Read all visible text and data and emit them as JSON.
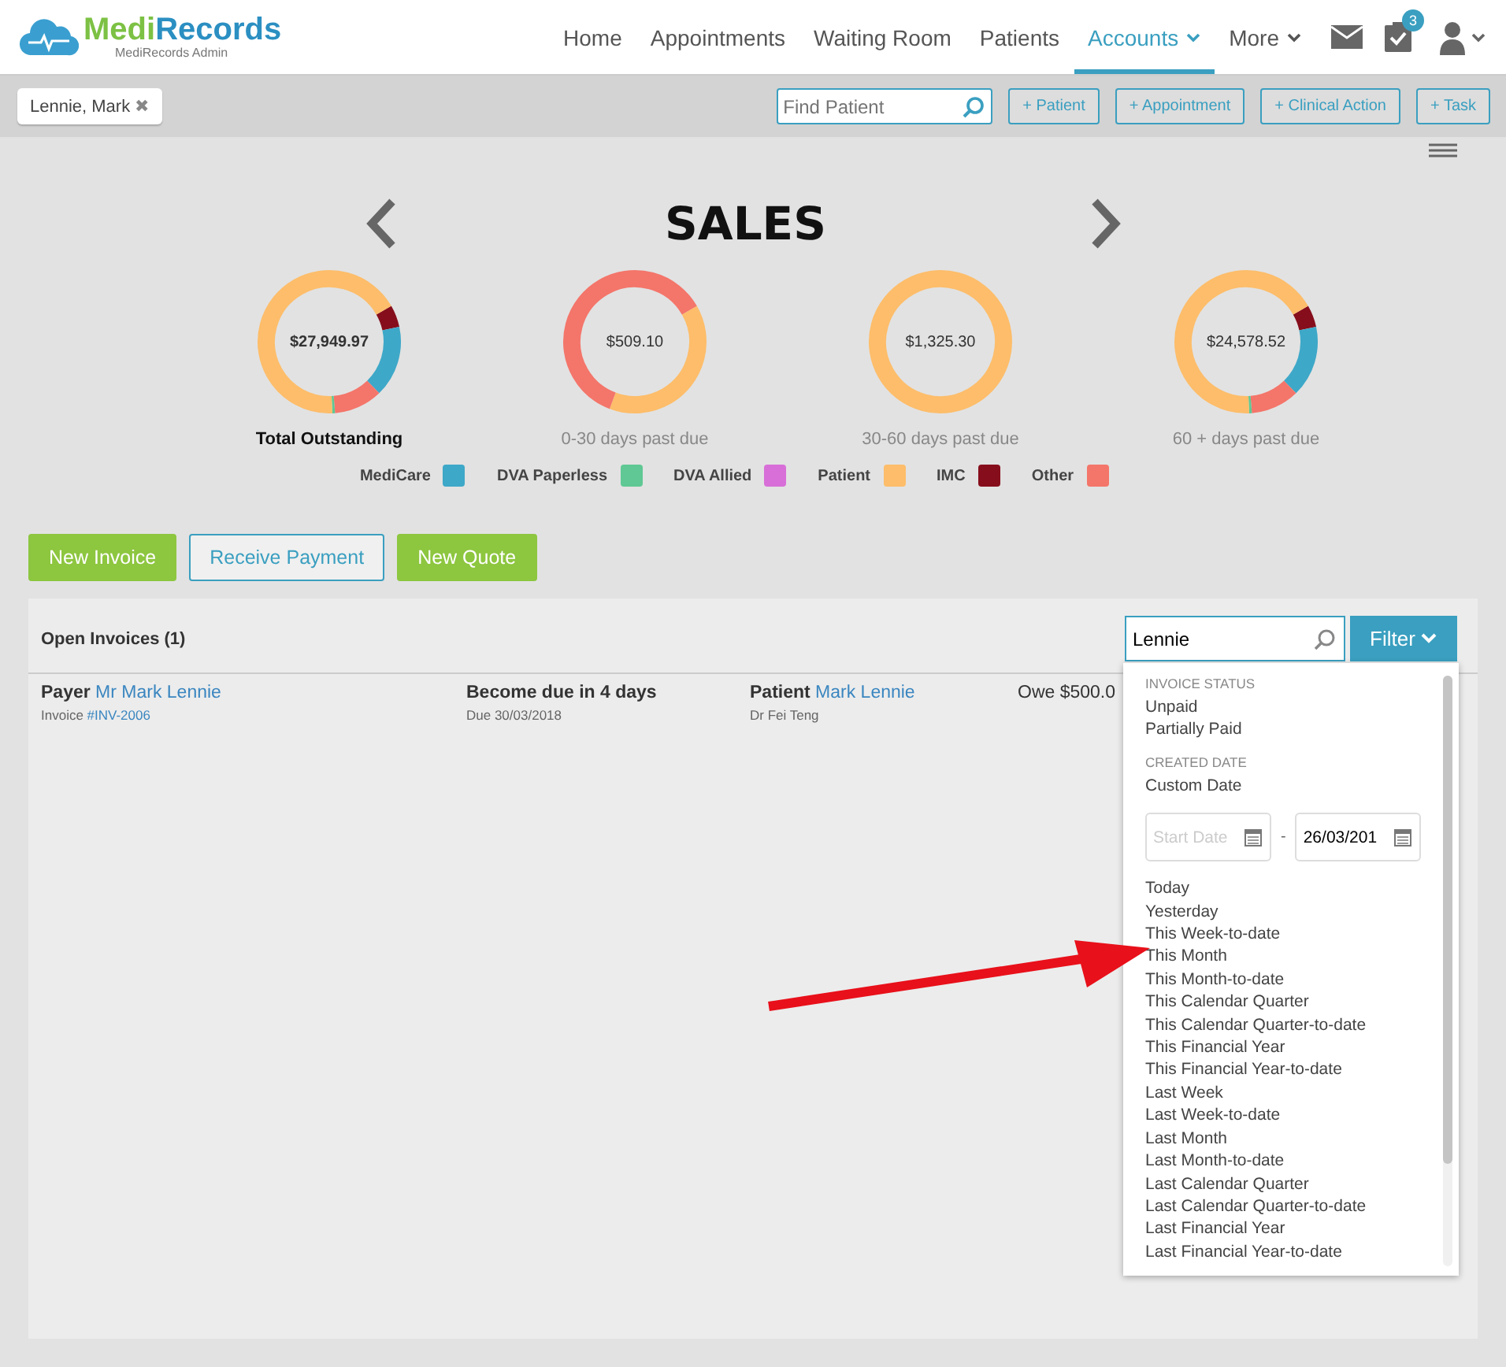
{
  "brand": {
    "name_part_1": "Medi",
    "name_part_2": "Records",
    "subtitle": "MediRecords Admin"
  },
  "nav": [
    {
      "label": "Home",
      "selected": false,
      "has_menu": false
    },
    {
      "label": "Appointments",
      "selected": false,
      "has_menu": false
    },
    {
      "label": "Waiting Room",
      "selected": false,
      "has_menu": false
    },
    {
      "label": "Patients",
      "selected": false,
      "has_menu": false
    },
    {
      "label": "Accounts",
      "selected": true,
      "has_menu": true
    },
    {
      "label": "More",
      "selected": false,
      "has_menu": true
    }
  ],
  "tasks_badge": "3",
  "patient_tab": {
    "label": "Lennie, Mark",
    "close": "✖"
  },
  "find_patient": {
    "placeholder": "Find Patient"
  },
  "quick_actions": [
    "+ Patient",
    "+ Appointment",
    "+ Clinical Action",
    "+ Task"
  ],
  "sales": {
    "title": "SALES",
    "donuts": [
      {
        "total": "$27,949.97",
        "label": "Total Outstanding",
        "emphasis": true
      },
      {
        "total": "$509.10",
        "label": "0-30 days past due",
        "emphasis": false
      },
      {
        "total": "$1,325.30",
        "label": "30-60 days past due",
        "emphasis": false
      },
      {
        "total": "$24,578.52",
        "label": "60 + days past due",
        "emphasis": false
      }
    ],
    "legend": [
      {
        "label": "MediCare",
        "color": "#3ea8c8"
      },
      {
        "label": "DVA Paperless",
        "color": "#5fc894"
      },
      {
        "label": "DVA Allied",
        "color": "#d86fd8"
      },
      {
        "label": "Patient",
        "color": "#fdbd6a"
      },
      {
        "label": "IMC",
        "color": "#860e1c"
      },
      {
        "label": "Other",
        "color": "#f4756a"
      }
    ]
  },
  "actions": [
    {
      "label": "New Invoice",
      "kind": "primary"
    },
    {
      "label": "Receive Payment",
      "kind": "outline"
    },
    {
      "label": "New Quote",
      "kind": "primary"
    }
  ],
  "invoices": {
    "title": "Open Invoices (1)",
    "search": {
      "value": "Lennie"
    },
    "filter_button": "Filter",
    "rows": [
      {
        "payer_label": "Payer",
        "payer": "Mr Mark Lennie",
        "invoice_label": "Invoice",
        "invoice": "#INV-2006",
        "due": "Become due in 4 days",
        "due_date": "Due 30/03/2018",
        "patient_label": "Patient",
        "patient": "Mark Lennie",
        "doctor": "Dr Fei Teng",
        "owe": "Owe $500.0"
      }
    ]
  },
  "filter_menu": {
    "sections": [
      {
        "heading": "INVOICE STATUS",
        "options": [
          "Unpaid",
          "Partially Paid"
        ]
      },
      {
        "heading": "CREATED DATE",
        "options": [
          "Custom Date"
        ]
      }
    ],
    "start_date": {
      "placeholder": "Start Date"
    },
    "separator": "-",
    "end_date": {
      "value": "26/03/201"
    },
    "presets": [
      "Today",
      "Yesterday",
      "This Week-to-date",
      "This Month",
      "This Month-to-date",
      "This Calendar Quarter",
      "This Calendar Quarter-to-date",
      "This Financial Year",
      "This Financial Year-to-date",
      "Last Week",
      "Last Week-to-date",
      "Last Month",
      "Last Month-to-date",
      "Last Calendar Quarter",
      "Last Calendar Quarter-to-date",
      "Last Financial Year",
      "Last Financial Year-to-date"
    ]
  }
}
